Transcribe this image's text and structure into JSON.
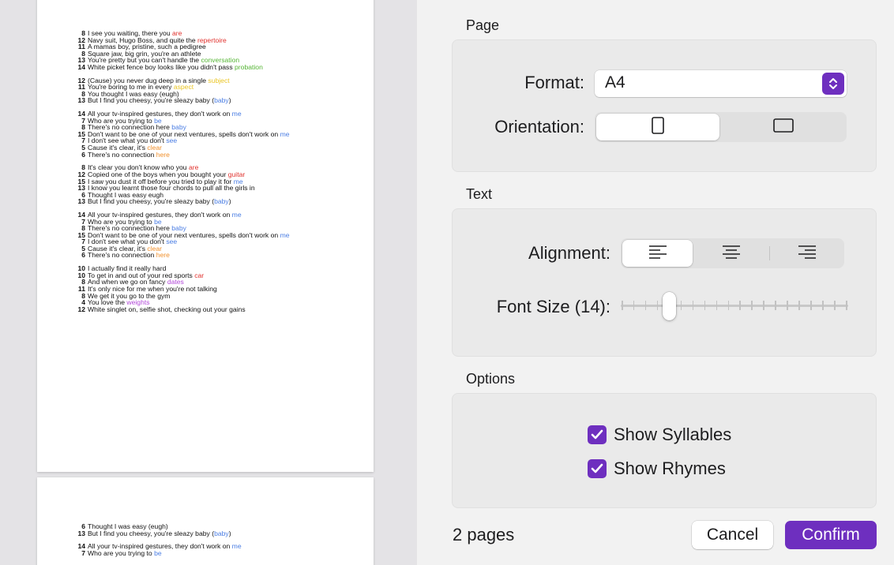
{
  "colors": {
    "accent": "#6e2fbf",
    "red": "#e0302c",
    "orange": "#f0902c",
    "yellow": "#eac523",
    "green": "#55b535",
    "blue": "#4a7de3",
    "purple": "#b248d8"
  },
  "preview": {
    "page1": [
      [
        {
          "n": "8",
          "t": "I see you waiting, there you ",
          "r": "are",
          "c": "red"
        },
        {
          "n": "12",
          "t": "Navy suit, Hugo Boss, and quite the ",
          "r": "repertoire",
          "c": "red"
        },
        {
          "n": "11",
          "t": "A mamas boy, pristine, such a pedigree",
          "r": "",
          "c": ""
        },
        {
          "n": "8",
          "t": "Square jaw, big grin, you're an athlete",
          "r": "",
          "c": ""
        },
        {
          "n": "13",
          "t": "You're pretty but you can't handle the ",
          "r": "conversation",
          "c": "green"
        },
        {
          "n": "14",
          "t": "White picket fence boy looks like you didn't pass ",
          "r": "probation",
          "c": "green"
        }
      ],
      [
        {
          "n": "12",
          "t": "(Cause) you never dug deep in a single ",
          "r": "subject",
          "c": "yellow"
        },
        {
          "n": "11",
          "t": "You're boring to me in every ",
          "r": "aspect",
          "c": "yellow"
        },
        {
          "n": "8",
          "t": "You thought I was easy (eugh)",
          "r": "",
          "c": ""
        },
        {
          "n": "13",
          "t": "But I find you cheesy, you're sleazy baby (",
          "r": "baby",
          "c": "blue",
          "t2": ")"
        }
      ],
      [
        {
          "n": "14",
          "t": "All your tv-inspired gestures, they don't work on ",
          "r": "me",
          "c": "blue"
        },
        {
          "n": "7",
          "t": "Who are you trying to ",
          "r": "be",
          "c": "blue"
        },
        {
          "n": "8",
          "t": "There's no connection here ",
          "r": "baby",
          "c": "blue"
        },
        {
          "n": "15",
          "t": "Don't want to be one of your next ventures, spells don't work on ",
          "r": "me",
          "c": "blue"
        },
        {
          "n": "7",
          "t": "I don't see what you don't ",
          "r": "see",
          "c": "blue"
        },
        {
          "n": "5",
          "t": "Cause it's clear, it's ",
          "r": "clear",
          "c": "orange"
        },
        {
          "n": "6",
          "t": "There's no connection ",
          "r": "here",
          "c": "orange"
        }
      ],
      [
        {
          "n": "8",
          "t": "It's clear you don't know who you ",
          "r": "are",
          "c": "red"
        },
        {
          "n": "12",
          "t": "Copied one of the boys when you bought your ",
          "r": "guitar",
          "c": "red"
        },
        {
          "n": "15",
          "t": "I saw you dust it off before you tried to play it for ",
          "r": "me",
          "c": "blue"
        },
        {
          "n": "13",
          "t": "I know you learnt those four chords to pull all the girls in",
          "r": "",
          "c": ""
        },
        {
          "n": "6",
          "t": "Thought I was easy eugh",
          "r": "",
          "c": ""
        },
        {
          "n": "13",
          "t": "But I find you cheesy, you're sleazy baby (",
          "r": "baby",
          "c": "blue",
          "t2": ")"
        }
      ],
      [
        {
          "n": "14",
          "t": "All your tv-inspired gestures, they don't work on ",
          "r": "me",
          "c": "blue"
        },
        {
          "n": "7",
          "t": "Who are you trying to ",
          "r": "be",
          "c": "blue"
        },
        {
          "n": "8",
          "t": "There's no connection here ",
          "r": "baby",
          "c": "blue"
        },
        {
          "n": "15",
          "t": "Don't want to be one of your next ventures, spells don't work on ",
          "r": "me",
          "c": "blue"
        },
        {
          "n": "7",
          "t": "I don't see what you don't ",
          "r": "see",
          "c": "blue"
        },
        {
          "n": "5",
          "t": "Cause it's clear, it's ",
          "r": "clear",
          "c": "orange"
        },
        {
          "n": "6",
          "t": "There's no connection ",
          "r": "here",
          "c": "orange"
        }
      ],
      [
        {
          "n": "10",
          "t": "I actually find it really hard",
          "r": "",
          "c": ""
        },
        {
          "n": "10",
          "t": "To get in and out of your red sports ",
          "r": "car",
          "c": "red"
        },
        {
          "n": "8",
          "t": "And when we go on fancy ",
          "r": "dates",
          "c": "purple"
        },
        {
          "n": "11",
          "t": "It's only nice for me when you're not talking",
          "r": "",
          "c": ""
        },
        {
          "n": "8",
          "t": "We get it you go to the gym",
          "r": "",
          "c": ""
        },
        {
          "n": "4",
          "t": "You love the ",
          "r": "weights",
          "c": "purple"
        },
        {
          "n": "12",
          "t": "White singlet on, selfie shot, checking out your gains",
          "r": "",
          "c": ""
        }
      ]
    ],
    "page2": [
      [
        {
          "n": "6",
          "t": "Thought I was easy (eugh)",
          "r": "",
          "c": ""
        },
        {
          "n": "13",
          "t": "But I find you cheesy, you're sleazy baby (",
          "r": "baby",
          "c": "blue",
          "t2": ")"
        }
      ],
      [
        {
          "n": "14",
          "t": "All your tv-inspired gestures, they don't work on ",
          "r": "me",
          "c": "blue"
        },
        {
          "n": "7",
          "t": "Who are you trying to ",
          "r": "be",
          "c": "blue"
        }
      ]
    ]
  },
  "settings": {
    "page_section": "Page",
    "format_label": "Format:",
    "format_value": "A4",
    "orientation_label": "Orientation:",
    "text_section": "Text",
    "alignment_label": "Alignment:",
    "font_size_label": "Font Size (14):",
    "font_size_slider": {
      "value": 14,
      "ticks": 20,
      "position_index": 4
    },
    "options_section": "Options",
    "show_syllables": "Show Syllables",
    "show_rhymes": "Show Rhymes"
  },
  "footer": {
    "pages": "2 pages",
    "cancel": "Cancel",
    "confirm": "Confirm"
  }
}
